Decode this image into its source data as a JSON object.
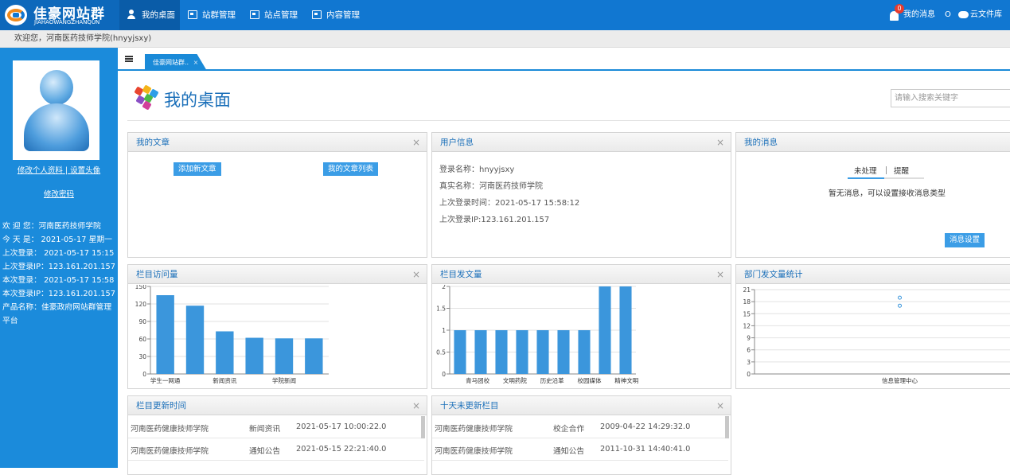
{
  "header": {
    "logo_title": "佳豪网站群",
    "logo_subtitle": "JIAHAOWANGZHANQUN",
    "nav": [
      {
        "label": "我的桌面",
        "icon": "user-desk-icon",
        "active": true
      },
      {
        "label": "站群管理",
        "icon": "window-icon"
      },
      {
        "label": "站点管理",
        "icon": "window-icon"
      },
      {
        "label": "内容管理",
        "icon": "window-icon"
      }
    ],
    "message_badge": "0",
    "messages_label": "我的消息",
    "separator": "O",
    "cloud_label": "云文件库"
  },
  "welcome_bar": "欢迎您，河南医药技师学院(hnyyjsxy)",
  "sidebar": {
    "edit_profile": "修改个人资料",
    "divider": "|",
    "set_avatar": "设置头像",
    "change_password": "修改密码",
    "info": [
      "欢 迎 您：河南医药技师学院",
      "今 天 是： 2021-05-17 星期一",
      "上次登录： 2021-05-17 15:15",
      "上次登录IP：123.161.201.157",
      "本次登录： 2021-05-17 15:58",
      "本次登录IP：123.161.201.157",
      "产品名称：佳豪政府网站群管理",
      "平台"
    ]
  },
  "tabs": [
    {
      "label": "佳豪网站群..",
      "close": "×"
    }
  ],
  "page": {
    "title": "我的桌面",
    "search_placeholder": "请输入搜索关键字"
  },
  "panels": {
    "articles": {
      "title": "我的文章",
      "close": "×",
      "add_button": "添加新文章",
      "list_button": "我的文章列表"
    },
    "user_info": {
      "title": "用户信息",
      "close": "×",
      "rows": [
        "登录名称：hnyyjsxy",
        "真实名称：河南医药技师学院",
        "上次登录时间：2021-05-17 15:58:12",
        "上次登录IP:123.161.201.157"
      ]
    },
    "messages": {
      "title": "我的消息",
      "close": "×",
      "tab_pending": "未处理",
      "tab_remind": "提醒",
      "empty_text": "暂无消息，可以设置接收消息类型",
      "settings_button": "消息设置"
    },
    "visits_title": "栏目访问量",
    "posts_title": "栏目发文量",
    "dept_title": "部门发文量统计",
    "update_time": {
      "title": "栏目更新时间",
      "close": "×",
      "rows": [
        {
          "org": "河南医药健康技师学院",
          "column": "新闻资讯",
          "time": "2021-05-17 10:00:22.0"
        },
        {
          "org": "河南医药健康技师学院",
          "column": "通知公告",
          "time": "2021-05-15 22:21:40.0"
        }
      ]
    },
    "stale": {
      "title": "十天未更新栏目",
      "close": "×",
      "rows": [
        {
          "org": "河南医药健康技师学院",
          "column": "校企合作",
          "time": "2009-04-22 14:29:32.0"
        },
        {
          "org": "河南医药健康技师学院",
          "column": "通知公告",
          "time": "2011-10-31 14:40:41.0"
        }
      ]
    }
  },
  "chart_data": [
    {
      "type": "bar",
      "categories": [
        "学生一网通",
        "",
        "新闻资讯",
        "",
        "学院新闻",
        ""
      ],
      "values": [
        135,
        117,
        73,
        62,
        61,
        61
      ],
      "ylim": [
        0,
        150
      ],
      "yticks": [
        0,
        30,
        60,
        90,
        120,
        150
      ],
      "color": "#3b96dc"
    },
    {
      "type": "bar",
      "categories": [
        "",
        "青马团校",
        "",
        "文明药院",
        "",
        "历史沿革",
        "",
        "校园媒体",
        "",
        "精神文明"
      ],
      "values": [
        1,
        1,
        1,
        1,
        1,
        1,
        1,
        2,
        2
      ],
      "ylim": [
        0,
        2
      ],
      "yticks": [
        0,
        0.5,
        1,
        1.5,
        2
      ],
      "color": "#3b96dc"
    },
    {
      "type": "scatter",
      "categories": [
        "信息管理中心"
      ],
      "values": [
        19,
        17
      ],
      "ylim": [
        0,
        21
      ],
      "yticks": [
        0,
        3,
        6,
        9,
        12,
        15,
        18,
        21
      ],
      "color": "#3b96dc"
    }
  ]
}
